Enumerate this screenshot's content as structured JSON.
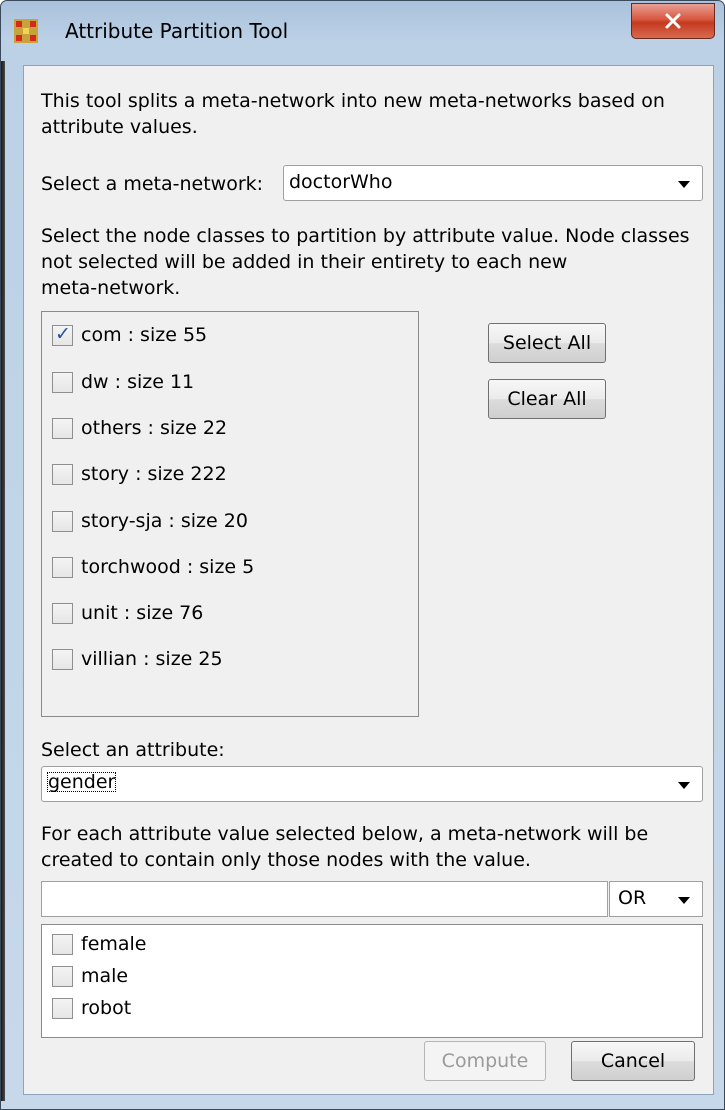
{
  "window": {
    "title": "Attribute Partition Tool"
  },
  "intro": {
    "line1": "This tool splits a meta-network into new meta-networks based on",
    "line2": "attribute values."
  },
  "meta_network": {
    "label": "Select a meta-network:",
    "value": "doctorWho"
  },
  "node_classes": {
    "desc1": "Select the node classes to partition by attribute value. Node classes",
    "desc2": "not selected will be added in their entirety to each new",
    "desc3": "meta-network.",
    "items": [
      {
        "label": "com : size 55",
        "checked": true
      },
      {
        "label": "dw : size 11",
        "checked": false
      },
      {
        "label": "others : size 22",
        "checked": false
      },
      {
        "label": "story : size 222",
        "checked": false
      },
      {
        "label": "story-sja : size 20",
        "checked": false
      },
      {
        "label": "torchwood : size 5",
        "checked": false
      },
      {
        "label": "unit : size 76",
        "checked": false
      },
      {
        "label": "villian : size 25",
        "checked": false
      }
    ],
    "select_all_label": "Select All",
    "clear_all_label": "Clear All"
  },
  "attribute": {
    "label": "Select an attribute:",
    "value": "gender"
  },
  "values": {
    "desc1": "For each attribute value selected below, a meta-network will be",
    "desc2": "created to contain only those nodes with the value.",
    "filter_value": "",
    "operator": "OR",
    "items": [
      {
        "label": "female",
        "checked": false
      },
      {
        "label": "male",
        "checked": false
      },
      {
        "label": "robot",
        "checked": false
      }
    ]
  },
  "footer": {
    "compute_label": "Compute",
    "cancel_label": "Cancel"
  },
  "icons": {
    "app": "network-grid-icon",
    "close": "close-icon",
    "dropdown": "chevron-down-icon"
  },
  "colors": {
    "close_button": "#c9442a",
    "check": "#2a4ea4"
  }
}
